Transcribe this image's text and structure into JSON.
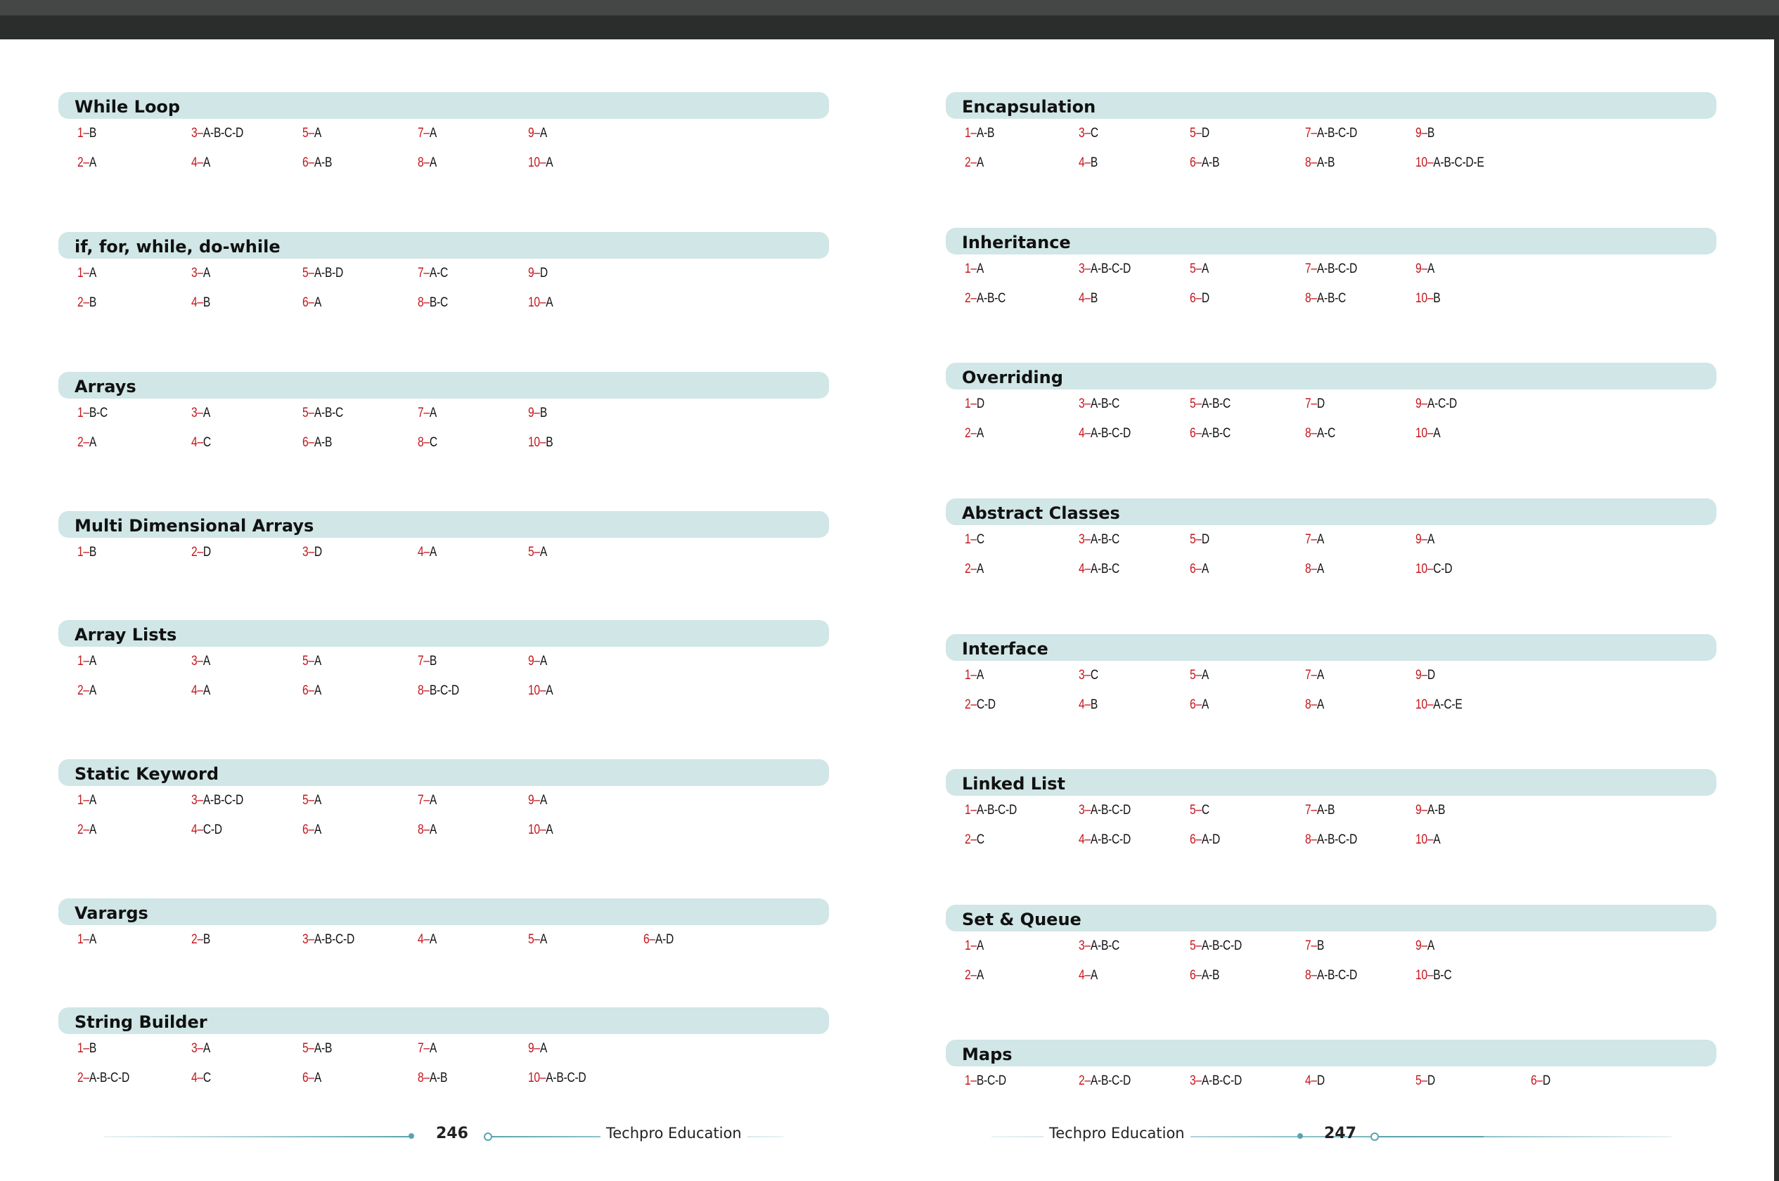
{
  "left_page": {
    "sections": [
      {
        "title": "While Loop",
        "rows": [
          [
            [
              "1",
              "B"
            ],
            [
              "3",
              "A-B-C-D"
            ],
            [
              "5",
              "A"
            ],
            [
              "7",
              "A"
            ],
            [
              "9",
              "A"
            ]
          ],
          [
            [
              "2",
              "A"
            ],
            [
              "4",
              "A"
            ],
            [
              "6",
              "A-B"
            ],
            [
              "8",
              "A"
            ],
            [
              "10",
              "A"
            ]
          ]
        ]
      },
      {
        "title": "if, for, while, do-while",
        "rows": [
          [
            [
              "1",
              "A"
            ],
            [
              "3",
              "A"
            ],
            [
              "5",
              "A-B-D"
            ],
            [
              "7",
              "A-C"
            ],
            [
              "9",
              "D"
            ]
          ],
          [
            [
              "2",
              "B"
            ],
            [
              "4",
              "B"
            ],
            [
              "6",
              "A"
            ],
            [
              "8",
              "B-C"
            ],
            [
              "10",
              "A"
            ]
          ]
        ]
      },
      {
        "title": "Arrays",
        "rows": [
          [
            [
              "1",
              "B-C"
            ],
            [
              "3",
              "A"
            ],
            [
              "5",
              "A-B-C"
            ],
            [
              "7",
              "A"
            ],
            [
              "9",
              "B"
            ]
          ],
          [
            [
              "2",
              "A"
            ],
            [
              "4",
              "C"
            ],
            [
              "6",
              "A-B"
            ],
            [
              "8",
              "C"
            ],
            [
              "10",
              "B"
            ]
          ]
        ]
      },
      {
        "title": "Multi Dimensional Arrays",
        "rows": [
          [
            [
              "1",
              "B"
            ],
            [
              "2",
              "D"
            ],
            [
              "3",
              "D"
            ],
            [
              "4",
              "A"
            ],
            [
              "5",
              "A"
            ]
          ]
        ]
      },
      {
        "title": "Array Lists",
        "rows": [
          [
            [
              "1",
              "A"
            ],
            [
              "3",
              "A"
            ],
            [
              "5",
              "A"
            ],
            [
              "7",
              "B"
            ],
            [
              "9",
              "A"
            ]
          ],
          [
            [
              "2",
              "A"
            ],
            [
              "4",
              "A"
            ],
            [
              "6",
              "A"
            ],
            [
              "8",
              "B-C-D"
            ],
            [
              "10",
              "A"
            ]
          ]
        ]
      },
      {
        "title": "Static Keyword",
        "rows": [
          [
            [
              "1",
              "A"
            ],
            [
              "3",
              "A-B-C-D"
            ],
            [
              "5",
              "A"
            ],
            [
              "7",
              "A"
            ],
            [
              "9",
              "A"
            ]
          ],
          [
            [
              "2",
              "A"
            ],
            [
              "4",
              "C-D"
            ],
            [
              "6",
              "A"
            ],
            [
              "8",
              "A"
            ],
            [
              "10",
              "A"
            ]
          ]
        ]
      },
      {
        "title": "Varargs",
        "rows": [
          [
            [
              "1",
              "A"
            ],
            [
              "2",
              "B"
            ],
            [
              "3",
              "A-B-C-D"
            ],
            [
              "4",
              "A"
            ],
            [
              "5",
              "A"
            ],
            [
              "6",
              "A-D"
            ]
          ]
        ]
      },
      {
        "title": "String Builder",
        "rows": [
          [
            [
              "1",
              "B"
            ],
            [
              "3",
              "A"
            ],
            [
              "5",
              "A-B"
            ],
            [
              "7",
              "A"
            ],
            [
              "9",
              "A"
            ]
          ],
          [
            [
              "2",
              "A-B-C-D"
            ],
            [
              "4",
              "C"
            ],
            [
              "6",
              "A"
            ],
            [
              "8",
              "A-B"
            ],
            [
              "10",
              "A-B-C-D"
            ]
          ]
        ]
      }
    ],
    "page_number": "246",
    "brand": "Techpro Education"
  },
  "right_page": {
    "sections": [
      {
        "title": "Encapsulation",
        "rows": [
          [
            [
              "1",
              "A-B"
            ],
            [
              "3",
              "C"
            ],
            [
              "5",
              "D"
            ],
            [
              "7",
              "A-B-C-D"
            ],
            [
              "9",
              "B"
            ]
          ],
          [
            [
              "2",
              "A"
            ],
            [
              "4",
              "B"
            ],
            [
              "6",
              "A-B"
            ],
            [
              "8",
              "A-B"
            ],
            [
              "10",
              "A-B-C-D-E"
            ]
          ]
        ]
      },
      {
        "title": "Inheritance",
        "rows": [
          [
            [
              "1",
              "A"
            ],
            [
              "3",
              "A-B-C-D"
            ],
            [
              "5",
              "A"
            ],
            [
              "7",
              "A-B-C-D"
            ],
            [
              "9",
              "A"
            ]
          ],
          [
            [
              "2",
              "A-B-C"
            ],
            [
              "4",
              "B"
            ],
            [
              "6",
              "D"
            ],
            [
              "8",
              "A-B-C"
            ],
            [
              "10",
              "B"
            ]
          ]
        ]
      },
      {
        "title": "Overriding",
        "rows": [
          [
            [
              "1",
              "D"
            ],
            [
              "3",
              "A-B-C"
            ],
            [
              "5",
              "A-B-C"
            ],
            [
              "7",
              "D"
            ],
            [
              "9",
              "A-C-D"
            ]
          ],
          [
            [
              "2",
              "A"
            ],
            [
              "4",
              "A-B-C-D"
            ],
            [
              "6",
              "A-B-C"
            ],
            [
              "8",
              "A-C"
            ],
            [
              "10",
              "A"
            ]
          ]
        ]
      },
      {
        "title": "Abstract Classes",
        "rows": [
          [
            [
              "1",
              "C"
            ],
            [
              "3",
              "A-B-C"
            ],
            [
              "5",
              "D"
            ],
            [
              "7",
              "A"
            ],
            [
              "9",
              "A"
            ]
          ],
          [
            [
              "2",
              "A"
            ],
            [
              "4",
              "A-B-C"
            ],
            [
              "6",
              "A"
            ],
            [
              "8",
              "A"
            ],
            [
              "10",
              "C-D"
            ]
          ]
        ]
      },
      {
        "title": "Interface",
        "rows": [
          [
            [
              "1",
              "A"
            ],
            [
              "3",
              "C"
            ],
            [
              "5",
              "A"
            ],
            [
              "7",
              "A"
            ],
            [
              "9",
              "D"
            ]
          ],
          [
            [
              "2",
              "C-D"
            ],
            [
              "4",
              "B"
            ],
            [
              "6",
              "A"
            ],
            [
              "8",
              "A"
            ],
            [
              "10",
              "A-C-E"
            ]
          ]
        ]
      },
      {
        "title": "Linked List",
        "rows": [
          [
            [
              "1",
              "A-B-C-D"
            ],
            [
              "3",
              "A-B-C-D"
            ],
            [
              "5",
              "C"
            ],
            [
              "7",
              "A-B"
            ],
            [
              "9",
              "A-B"
            ]
          ],
          [
            [
              "2",
              "C"
            ],
            [
              "4",
              "A-B-C-D"
            ],
            [
              "6",
              "A-D"
            ],
            [
              "8",
              "A-B-C-D"
            ],
            [
              "10",
              "A"
            ]
          ]
        ]
      },
      {
        "title": "Set & Queue",
        "rows": [
          [
            [
              "1",
              "A"
            ],
            [
              "3",
              "A-B-C"
            ],
            [
              "5",
              "A-B-C-D"
            ],
            [
              "7",
              "B"
            ],
            [
              "9",
              "A"
            ]
          ],
          [
            [
              "2",
              "A"
            ],
            [
              "4",
              "A"
            ],
            [
              "6",
              "A-B"
            ],
            [
              "8",
              "A-B-C-D"
            ],
            [
              "10",
              "B-C"
            ]
          ]
        ]
      },
      {
        "title": "Maps",
        "rows": [
          [
            [
              "1",
              "B-C-D"
            ],
            [
              "2",
              "A-B-C-D"
            ],
            [
              "3",
              "A-B-C-D"
            ],
            [
              "4",
              "D"
            ],
            [
              "5",
              "D"
            ],
            [
              "6",
              "D"
            ]
          ]
        ]
      }
    ],
    "page_number": "247",
    "brand": "Techpro Education"
  }
}
